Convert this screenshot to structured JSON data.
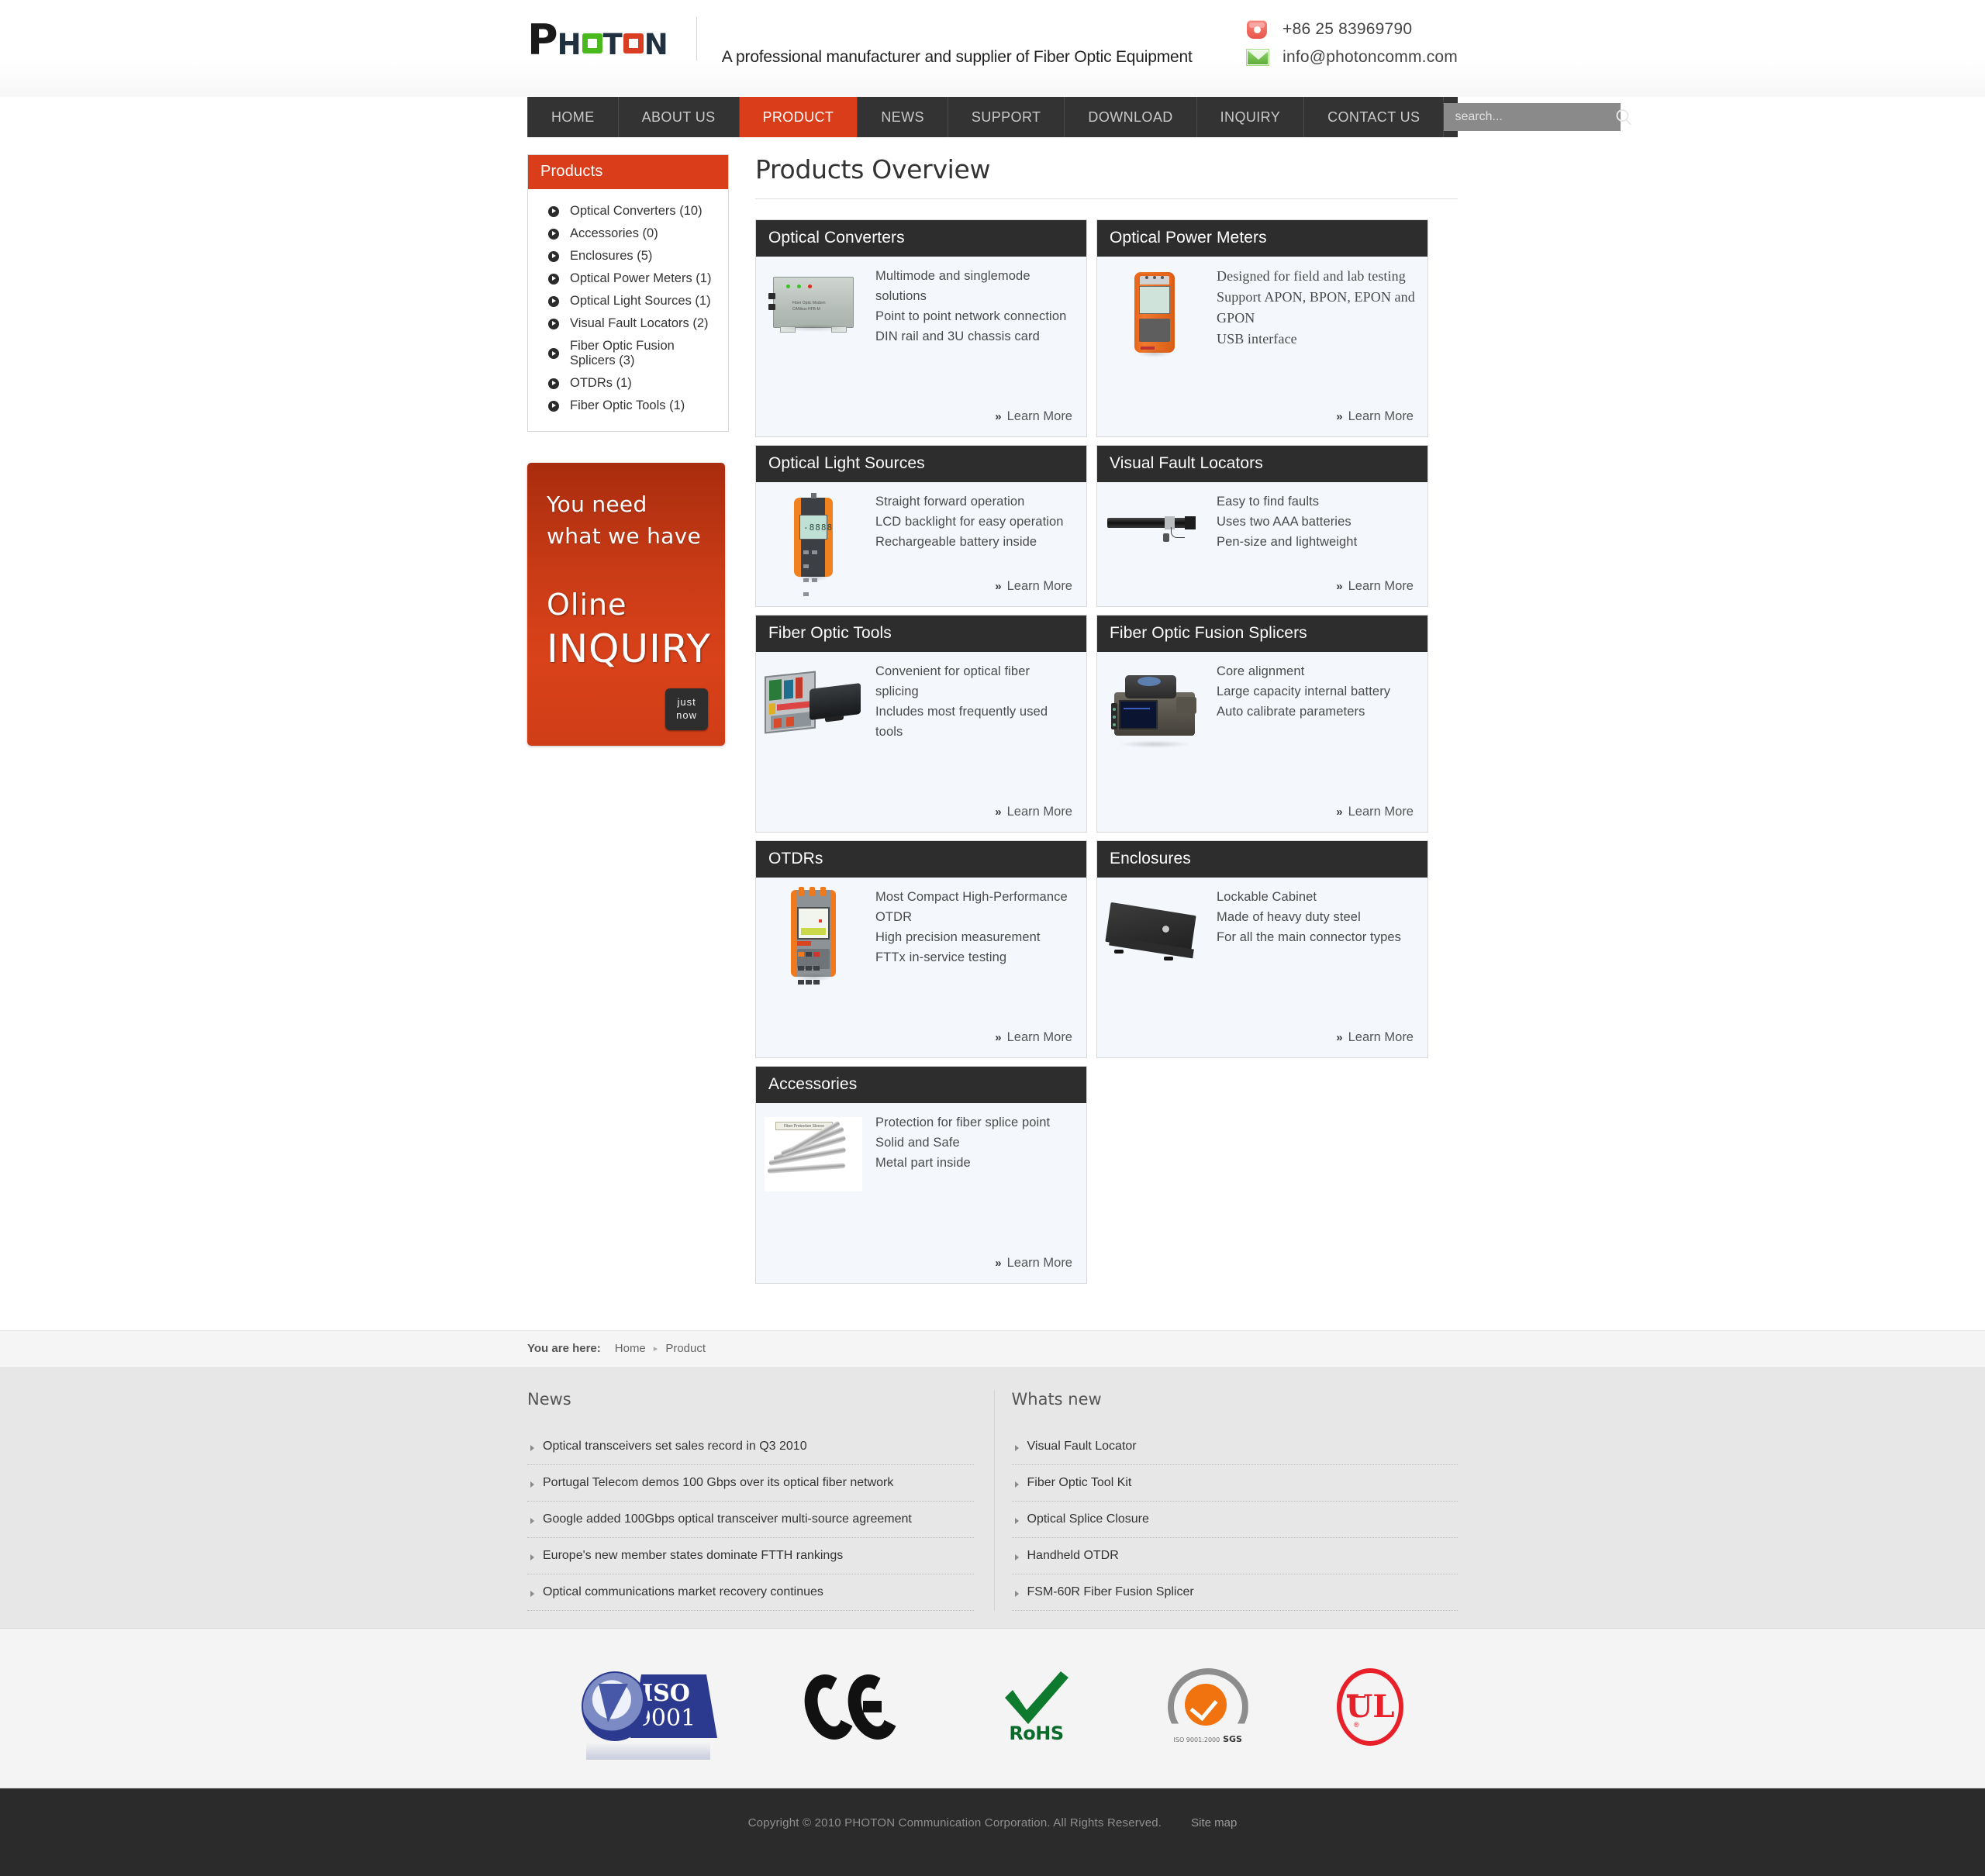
{
  "header": {
    "logo": {
      "p": "P",
      "h": "H",
      "o1": "O",
      "t": "T",
      "o2": "O",
      "n": "N",
      "full": "PHOTON"
    },
    "tagline": "A professional manufacturer and supplier of Fiber Optic Equipment",
    "phone": "+86 25 83969790",
    "email": "info@photoncomm.com"
  },
  "nav": {
    "items": [
      {
        "label": "HOME",
        "active": false
      },
      {
        "label": "ABOUT US",
        "active": false
      },
      {
        "label": "PRODUCT",
        "active": true
      },
      {
        "label": "NEWS",
        "active": false
      },
      {
        "label": "SUPPORT",
        "active": false
      },
      {
        "label": "DOWNLOAD",
        "active": false
      },
      {
        "label": "INQUIRY",
        "active": false
      },
      {
        "label": "CONTACT US",
        "active": false
      }
    ],
    "search_placeholder": "search...",
    "search_value": ""
  },
  "sidebar": {
    "heading": "Products",
    "items": [
      {
        "label": "Optical Converters (10)"
      },
      {
        "label": "Accessories (0)"
      },
      {
        "label": "Enclosures (5)"
      },
      {
        "label": "Optical Power Meters (1)"
      },
      {
        "label": "Optical Light Sources (1)"
      },
      {
        "label": "Visual Fault Locators (2)"
      },
      {
        "label": "Fiber Optic Fusion Splicers (3)"
      },
      {
        "label": "OTDRs (1)"
      },
      {
        "label": "Fiber Optic Tools (1)"
      }
    ],
    "banner": {
      "line1": "You need",
      "line2": "what we have",
      "big1": "Oline",
      "big2": "INQUIRY",
      "button_line1": "just",
      "button_line2": "now"
    }
  },
  "main": {
    "title": "Products Overview",
    "learn_more": "Learn More",
    "cards": [
      {
        "title": "Optical Converters",
        "features": [
          "Multimode and singlemode solutions",
          "Point to point network connection",
          "DIN rail and 3U chassis card"
        ]
      },
      {
        "title": "Optical Power Meters",
        "features": [
          "Designed for field and lab testing",
          "Support APON, BPON, EPON and GPON",
          "USB interface"
        ]
      },
      {
        "title": "Optical Light Sources",
        "features": [
          "Straight forward operation",
          "LCD backlight for easy operation",
          "Rechargeable battery inside"
        ]
      },
      {
        "title": "Visual Fault Locators",
        "features": [
          "Easy to find faults",
          "Uses two AAA batteries",
          "Pen-size and lightweight"
        ]
      },
      {
        "title": "Fiber Optic Tools",
        "features": [
          "Convenient for optical fiber splicing",
          "Includes most frequently used  tools"
        ]
      },
      {
        "title": "Fiber Optic Fusion Splicers",
        "features": [
          "Core alignment",
          "Large capacity internal battery",
          "Auto calibrate parameters"
        ]
      },
      {
        "title": "OTDRs",
        "features": [
          "Most Compact High-Performance OTDR",
          "High precision measurement",
          "FTTx in-service testing"
        ]
      },
      {
        "title": "Enclosures",
        "features": [
          "Lockable Cabinet",
          "Made of heavy duty steel",
          "For all the main connector types"
        ]
      },
      {
        "title": "Accessories",
        "features": [
          "Protection for fiber splice point",
          "Solid and Safe",
          "Metal part inside"
        ]
      }
    ]
  },
  "breadcrumb": {
    "label": "You are here:",
    "home": "Home",
    "separator": "▸",
    "current": "Product"
  },
  "footer_lists": {
    "news": {
      "heading": "News",
      "items": [
        "Optical transceivers set sales record in Q3 2010",
        "Portugal Telecom demos 100 Gbps over its optical fiber network",
        "Google added 100Gbps optical transceiver multi-source agreement",
        "Europe's new member states dominate FTTH rankings",
        "Optical communications market recovery continues"
      ]
    },
    "whats_new": {
      "heading": "Whats new",
      "items": [
        "Visual Fault Locator",
        "Fiber Optic Tool Kit",
        "Optical Splice Closure",
        "Handheld OTDR",
        "FSM-60R Fiber Fusion Splicer"
      ]
    }
  },
  "certifications": [
    {
      "name": "ISO 9001",
      "line1": "ISO",
      "line2": "9001"
    },
    {
      "name": "CE"
    },
    {
      "name": "RoHS",
      "label": "RoHS"
    },
    {
      "name": "SGS",
      "label": "SGS",
      "sub": "ISO 9001:2000"
    },
    {
      "name": "UL",
      "label": "UL"
    }
  ],
  "footer": {
    "copyright": "Copyright © 2010 PHOTON Communication Corporation. All Rights Reserved.",
    "sitemap": "Site map"
  },
  "colors": {
    "accent": "#d93d1a",
    "nav_bg": "#333333",
    "card_head": "#2d2d2d",
    "card_body": "#f4f8fd",
    "dark_footer": "#2b2b2b"
  }
}
